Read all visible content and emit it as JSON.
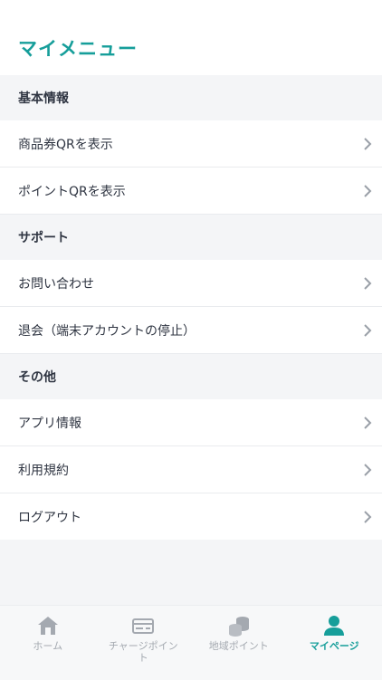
{
  "header": {
    "title": "マイメニュー"
  },
  "sections": [
    {
      "label": "基本情報",
      "items": [
        {
          "label": "商品券QRを表示"
        },
        {
          "label": "ポイントQRを表示"
        }
      ]
    },
    {
      "label": "サポート",
      "items": [
        {
          "label": "お問い合わせ"
        },
        {
          "label": "退会（端末アカウントの停止）"
        }
      ]
    },
    {
      "label": "その他",
      "items": [
        {
          "label": "アプリ情報"
        },
        {
          "label": "利用規約"
        },
        {
          "label": "ログアウト"
        }
      ]
    }
  ],
  "tabbar": {
    "tabs": [
      {
        "label": "ホーム",
        "icon": "home-icon"
      },
      {
        "label": "チャージポイント",
        "icon": "card-icon"
      },
      {
        "label": "地域ポイント",
        "icon": "coins-icon"
      },
      {
        "label": "マイページ",
        "icon": "person-icon"
      }
    ],
    "active_index": 3
  },
  "colors": {
    "accent": "#169e9a",
    "inactive": "#a4a9b0",
    "section_bg": "#f4f5f7"
  }
}
